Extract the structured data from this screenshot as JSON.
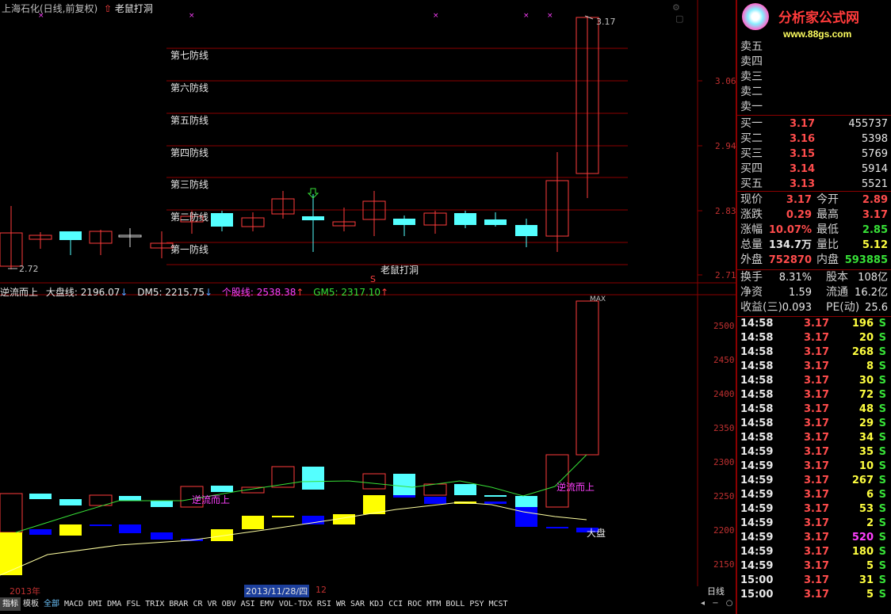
{
  "top_panel": {
    "title": "上海石化(日线,前复权)",
    "indicator": "老鼠打洞",
    "high_label": "3.17",
    "low_label": "2.72",
    "defense_lines": [
      "第七防线",
      "第六防线",
      "第五防线",
      "第四防线",
      "第三防线",
      "第二防线",
      "第一防线"
    ],
    "signal_label": "老鼠打洞",
    "signal_marker": "S",
    "price_axis": [
      "3.06",
      "2.94",
      "2.83",
      "2.71"
    ]
  },
  "bottom_panel": {
    "title_name": "逆流而上",
    "dapan_label": "大盘线:",
    "dapan_value": "2196.07",
    "dm5_label": "DM5:",
    "dm5_value": "2215.75",
    "gegu_label": "个股线:",
    "gegu_value": "2538.38",
    "gm5_label": "GM5:",
    "gm5_value": "2317.10",
    "annot_1": "逆流而上",
    "annot_2": "逆流而上",
    "annot_dapan": "大盘",
    "max_label": "MAX",
    "axis": [
      "2500",
      "2450",
      "2400",
      "2350",
      "2300",
      "2250",
      "2200",
      "2150"
    ]
  },
  "date_bar": {
    "year": "2013年",
    "date": "2013/11/28/四",
    "month": "12"
  },
  "period": "日线",
  "tabs": [
    "指标",
    "模板",
    "全部",
    "MACD",
    "DMI",
    "DMA",
    "FSL",
    "TRIX",
    "BRAR",
    "CR",
    "VR",
    "OBV",
    "ASI",
    "EMV",
    "VOL-TDX",
    "RSI",
    "WR",
    "SAR",
    "KDJ",
    "CCI",
    "ROC",
    "MTM",
    "BOLL",
    "PSY",
    "MCST"
  ],
  "logo": {
    "title": "分析家公式网",
    "url": "www.88gs.com"
  },
  "sell": [
    "卖五",
    "卖四",
    "卖三",
    "卖二",
    "卖一"
  ],
  "buy": [
    {
      "label": "买一",
      "price": "3.17",
      "vol": "455737"
    },
    {
      "label": "买二",
      "price": "3.16",
      "vol": "5398"
    },
    {
      "label": "买三",
      "price": "3.15",
      "vol": "5769"
    },
    {
      "label": "买四",
      "price": "3.14",
      "vol": "5914"
    },
    {
      "label": "买五",
      "price": "3.13",
      "vol": "5521"
    }
  ],
  "quote": [
    {
      "l1": "现价",
      "v1": "3.17",
      "l2": "今开",
      "v2": "2.89"
    },
    {
      "l1": "涨跌",
      "v1": "0.29",
      "l2": "最高",
      "v2": "3.17"
    },
    {
      "l1": "涨幅",
      "v1": "10.07%",
      "l2": "最低",
      "v2": "2.85"
    },
    {
      "l1": "总量",
      "v1": "134.7万",
      "l2": "量比",
      "v2": "5.12"
    },
    {
      "l1": "外盘",
      "v1": "752870",
      "l2": "内盘",
      "v2": "593885"
    }
  ],
  "fundamentals": [
    {
      "l1": "换手",
      "v1": "8.31%",
      "l2": "股本",
      "v2": "108亿"
    },
    {
      "l1": "净资",
      "v1": "1.59",
      "l2": "流通",
      "v2": "16.2亿"
    },
    {
      "l1": "收益(三)",
      "v1": "0.093",
      "l2": "PE(动)",
      "v2": "25.6"
    }
  ],
  "ticks": [
    {
      "t": "14:58",
      "p": "3.17",
      "v": "196",
      "s": "S"
    },
    {
      "t": "14:58",
      "p": "3.17",
      "v": "20",
      "s": "S"
    },
    {
      "t": "14:58",
      "p": "3.17",
      "v": "268",
      "s": "S"
    },
    {
      "t": "14:58",
      "p": "3.17",
      "v": "8",
      "s": "S"
    },
    {
      "t": "14:58",
      "p": "3.17",
      "v": "30",
      "s": "S"
    },
    {
      "t": "14:58",
      "p": "3.17",
      "v": "72",
      "s": "S"
    },
    {
      "t": "14:58",
      "p": "3.17",
      "v": "48",
      "s": "S"
    },
    {
      "t": "14:58",
      "p": "3.17",
      "v": "29",
      "s": "S"
    },
    {
      "t": "14:58",
      "p": "3.17",
      "v": "34",
      "s": "S"
    },
    {
      "t": "14:59",
      "p": "3.17",
      "v": "35",
      "s": "S"
    },
    {
      "t": "14:59",
      "p": "3.17",
      "v": "10",
      "s": "S"
    },
    {
      "t": "14:59",
      "p": "3.17",
      "v": "267",
      "s": "S"
    },
    {
      "t": "14:59",
      "p": "3.17",
      "v": "6",
      "s": "S"
    },
    {
      "t": "14:59",
      "p": "3.17",
      "v": "53",
      "s": "S"
    },
    {
      "t": "14:59",
      "p": "3.17",
      "v": "2",
      "s": "S"
    },
    {
      "t": "14:59",
      "p": "3.17",
      "v": "520",
      "s": "S"
    },
    {
      "t": "14:59",
      "p": "3.17",
      "v": "180",
      "s": "S"
    },
    {
      "t": "14:59",
      "p": "3.17",
      "v": "5",
      "s": "S"
    },
    {
      "t": "15:00",
      "p": "3.17",
      "v": "31",
      "s": "S"
    },
    {
      "t": "15:00",
      "p": "3.17",
      "v": "5",
      "s": "S"
    }
  ],
  "colors": {
    "up": "#ff3b3b",
    "down": "#54ffff",
    "grid": "#8b0000",
    "dapan_up": "#ffff00",
    "dapan_down": "#0000ff"
  }
}
